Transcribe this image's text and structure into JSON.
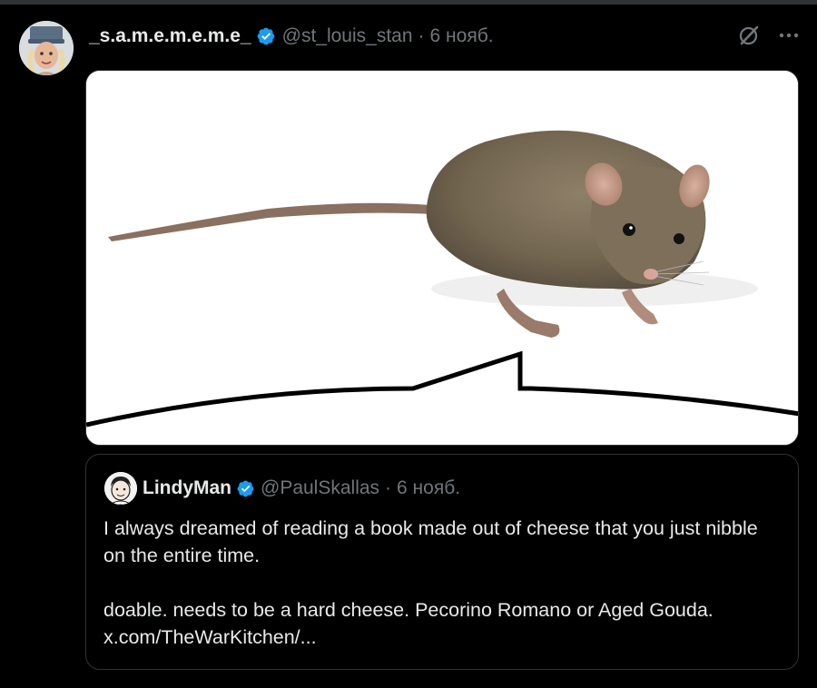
{
  "tweet": {
    "author_name": "_s.a.m.e.m.e.m.e_",
    "handle": "@st_louis_stan",
    "separator": "·",
    "date": "6 нояб.",
    "verified_icon": "verified-badge-icon",
    "actions": [
      "grok-icon",
      "more-icon"
    ],
    "media": {
      "description_icon": "mouse-photo"
    }
  },
  "quote": {
    "author_name": "LindyMan",
    "handle": "@PaulSkallas",
    "separator": "·",
    "date": "6 нояб.",
    "paragraph1": "I always dreamed of reading a book made out of cheese that you just nibble on the entire time.",
    "paragraph2": "doable. needs to be a hard cheese. Pecorino Romano or Aged Gouda. x.com/TheWarKitchen/..."
  },
  "colors": {
    "background": "#000000",
    "text_primary": "#e7e9ea",
    "text_secondary": "#71767b",
    "verified_blue": "#1d9bf0",
    "border": "#2f3336"
  }
}
